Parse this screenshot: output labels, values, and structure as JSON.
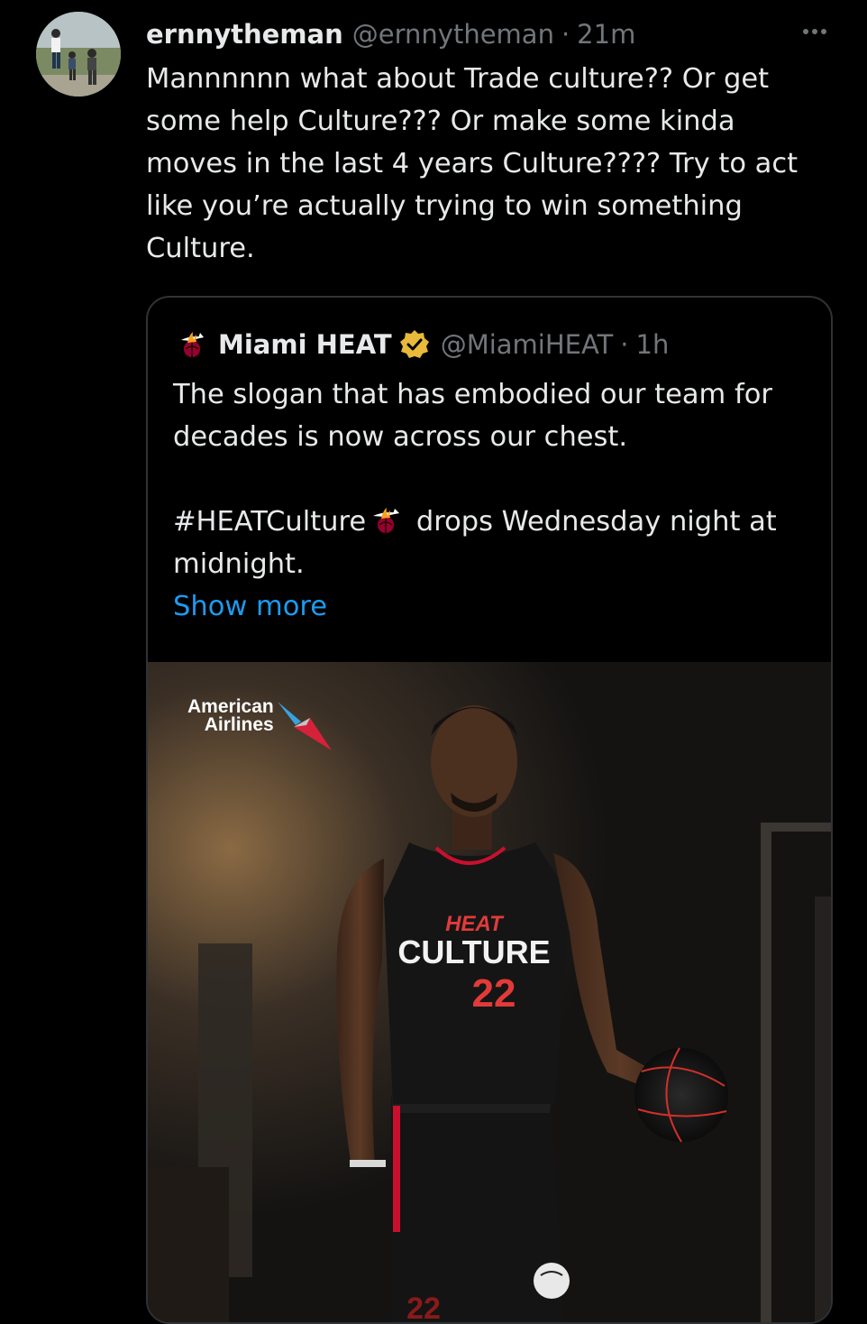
{
  "tweet": {
    "display_name": "ernnytheman",
    "handle": "@ernnytheman",
    "separator": "·",
    "time": "21m",
    "text": "Mannnnnn what about Trade culture?? Or get\nsome help Culture??? Or make some kinda\nmoves in the last 4 years Culture???? Try to act\nlike you’re actually trying to win something\nCulture.",
    "more_icon": "more-horizontal-icon"
  },
  "quote": {
    "display_name": "Miami HEAT",
    "handle": "@MiamiHEAT",
    "separator": "·",
    "time": "1h",
    "verified_icon": "verified-badge-icon",
    "logo_icon": "miami-heat-logo-icon",
    "line1": "The slogan that has embodied our team for",
    "line2": "decades is now across our chest.",
    "hashtag": "#HEATCulture",
    "line3_rest": " drops Wednesday night at",
    "line4": "midnight.",
    "show_more": "Show more",
    "colors": {
      "link": "#1d9bf0",
      "verified": "#e8b93a",
      "heat_red": "#98002e"
    }
  },
  "media": {
    "sponsor_line1": "American",
    "sponsor_line2": "Airlines",
    "jersey_word1": "HEAT",
    "jersey_word2": "CULTURE",
    "jersey_number": "22",
    "shorts_number": "22"
  }
}
